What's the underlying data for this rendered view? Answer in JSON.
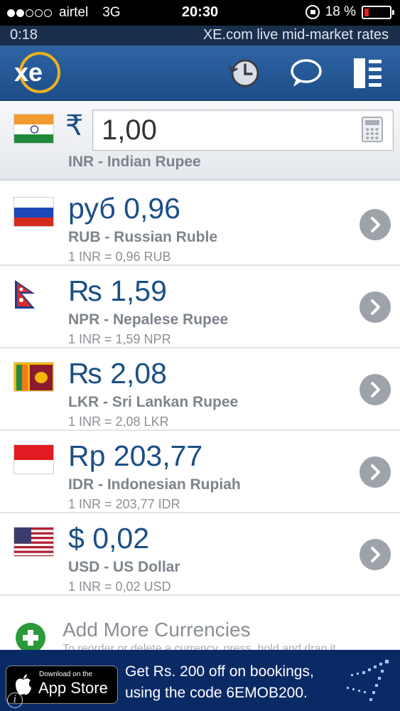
{
  "status_bar": {
    "carrier": "airtel",
    "network": "3G",
    "time": "20:30",
    "battery": "18 %",
    "battery_level": 0.18,
    "signal_bars": 2
  },
  "info_bar": {
    "timer": "0:18",
    "tagline": "XE.com live mid-market rates"
  },
  "header": {
    "logo_text": "xe",
    "icons": [
      "history-icon",
      "chat-icon",
      "menu-icon"
    ]
  },
  "base": {
    "symbol": "₹",
    "amount": "1,00",
    "name": "INR - Indian Rupee"
  },
  "currencies": [
    {
      "amount": "руб 0,96",
      "name": "RUB - Russian Ruble",
      "rate": "1 INR = 0,96 RUB"
    },
    {
      "amount": "₨ 1,59",
      "name": "NPR - Nepalese Rupee",
      "rate": "1 INR = 1,59 NPR"
    },
    {
      "amount": "₨ 2,08",
      "name": "LKR - Sri Lankan Rupee",
      "rate": "1 INR = 2,08 LKR"
    },
    {
      "amount": "Rp 203,77",
      "name": "IDR - Indonesian Rupiah",
      "rate": "1 INR = 203,77 IDR"
    },
    {
      "amount": "$ 0,02",
      "name": "USD - US Dollar",
      "rate": "1 INR = 0,02 USD"
    }
  ],
  "add_more": {
    "label": "Add More Currencies",
    "hint": "To reorder or delete a currency, press, hold and drag it"
  },
  "ad": {
    "badge_small": "Download on the",
    "badge_big": "App Store",
    "line1": "Get Rs. 200 off on bookings,",
    "line2": "using the code 6EMOB200."
  },
  "colors": {
    "header_blue": "#2f64a3",
    "amount_blue": "#1b4f85",
    "ad_navy": "#0a2a66",
    "add_green": "#2a9a3a"
  }
}
